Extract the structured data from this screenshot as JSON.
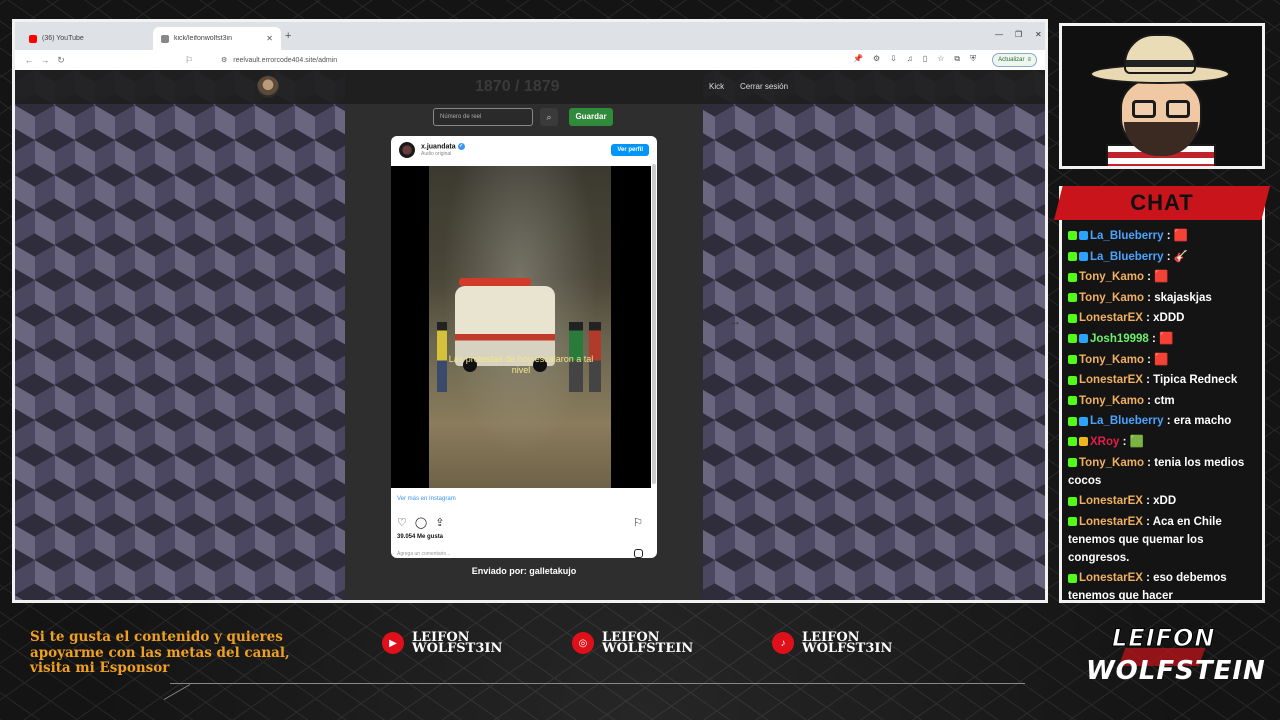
{
  "browser": {
    "tabs": [
      {
        "title": "(36) YouTube",
        "favicon_color": "#ff0000",
        "active": false
      },
      {
        "title": "kick/leifonwolfst3in",
        "favicon_color": "#888888",
        "active": true
      }
    ],
    "new_tab": "+",
    "url": "reelvault.errorcode404.site/admin",
    "update_label": "Actualizar"
  },
  "site": {
    "ghost_title": "1870 / 1879",
    "nav": {
      "kick": "Kick",
      "logout": "Cerrar sesión"
    },
    "reel_input_placeholder": "Número de reel",
    "save_label": "Guardar",
    "sent_by": "Enviado por: galletakujo"
  },
  "instagram": {
    "username": "x.juandata",
    "subtitle": "Audio original",
    "profile_button": "Ver perfil",
    "caption": "Las protestas de hoy escalaron a tal nivel",
    "view_more": "Ver más en Instagram",
    "likes": "39.054 Me gusta",
    "comment_placeholder": "Agrega un comentario..."
  },
  "chat": {
    "title": "CHAT",
    "messages": [
      {
        "user": "La_Blueberry",
        "color": "#4aa3ff",
        "text": ": 🟥"
      },
      {
        "user": "La_Blueberry",
        "color": "#4aa3ff",
        "text": ": 🎸"
      },
      {
        "user": "Tony_Kamo",
        "color": "#f0b060",
        "text": ": 🟥"
      },
      {
        "user": "Tony_Kamo",
        "color": "#f0b060",
        "text": ": skajaskjas"
      },
      {
        "user": "LonestarEX",
        "color": "#f0b060",
        "text": ": xDDD"
      },
      {
        "user": "Josh19998",
        "color": "#6ef06e",
        "text": ": 🟥"
      },
      {
        "user": "Tony_Kamo",
        "color": "#f0b060",
        "text": ": 🟥"
      },
      {
        "user": "LonestarEX",
        "color": "#f0b060",
        "text": ": Tipica Redneck"
      },
      {
        "user": "Tony_Kamo",
        "color": "#f0b060",
        "text": ": ctm"
      },
      {
        "user": "La_Blueberry",
        "color": "#4aa3ff",
        "text": ": era macho"
      },
      {
        "user": "XRoy",
        "color": "#e0204a",
        "text": ": 🟩"
      },
      {
        "user": "Tony_Kamo",
        "color": "#f0b060",
        "text": ": tenia los medios cocos"
      },
      {
        "user": "LonestarEX",
        "color": "#f0b060",
        "text": ": xDD"
      },
      {
        "user": "LonestarEX",
        "color": "#f0b060",
        "text": ": Aca en Chile tenemos que quemar los congresos."
      },
      {
        "user": "LonestarEX",
        "color": "#f0b060",
        "text": ": eso debemos tenemos que hacer"
      }
    ]
  },
  "overlay": {
    "sponsor_text": "Si te gusta el contenido y quieres apoyarme con las metas del canal, visita mi Esponsor",
    "socials": [
      {
        "icon": "youtube-icon",
        "line1": "LEIFON",
        "line2": "WOLFST3IN"
      },
      {
        "icon": "instagram-icon",
        "line1": "LEIFON",
        "line2": "WOLFSTEIN"
      },
      {
        "icon": "tiktok-icon",
        "line1": "LEIFON",
        "line2": "WOLFST3IN"
      }
    ],
    "brand_top": "LEIFON",
    "brand_bottom": "WOLFSTEIN"
  }
}
